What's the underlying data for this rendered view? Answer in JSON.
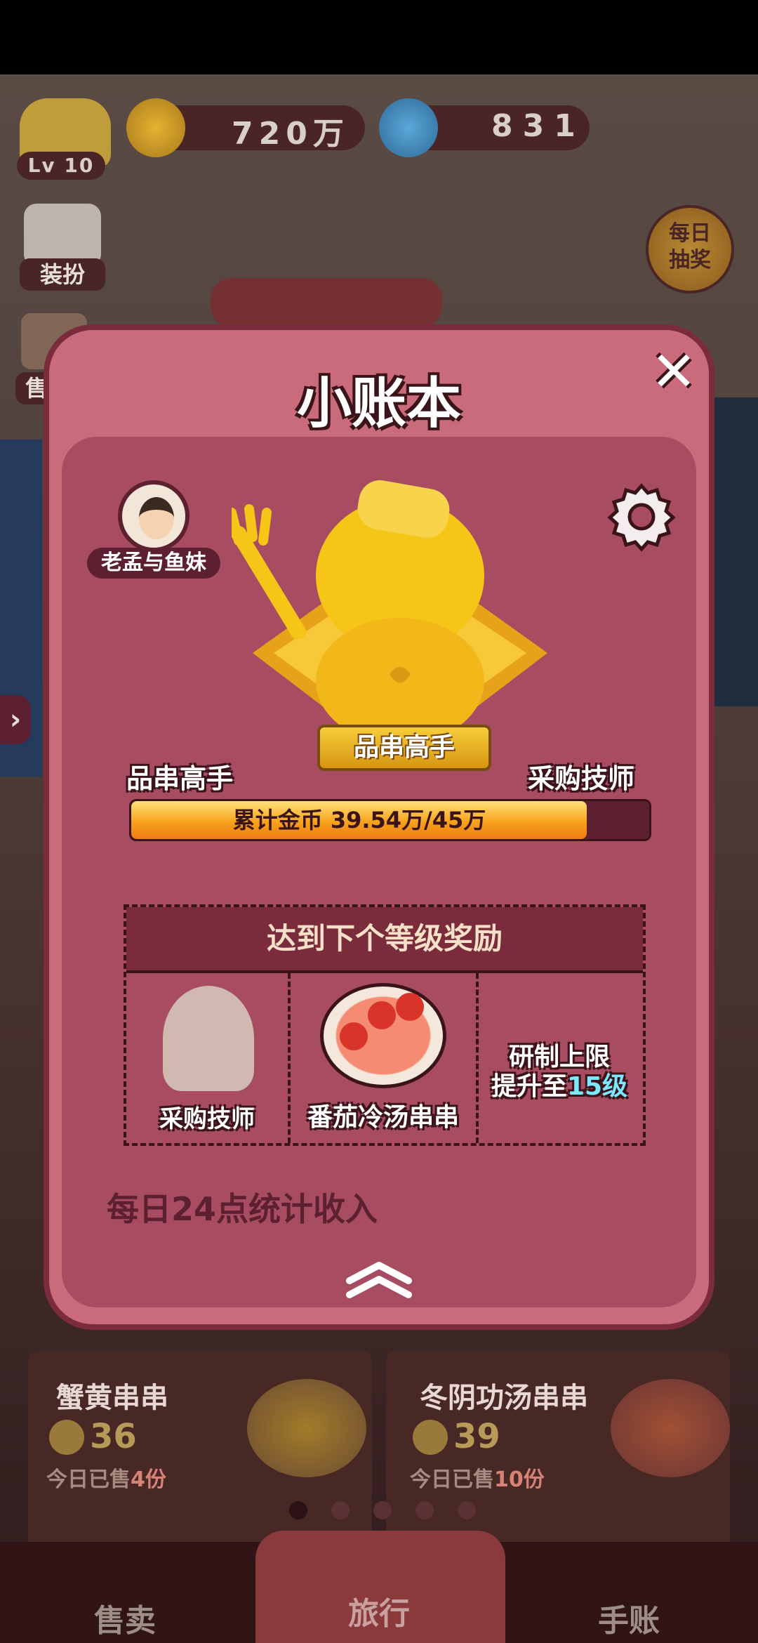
{
  "top_bar": {
    "level": "Lv 10",
    "coins": "720万",
    "buttons": "831"
  },
  "side_buttons": [
    {
      "label": "装扮"
    },
    {
      "label": "售"
    }
  ],
  "daily_lottery": {
    "label": "每日\n抽奖"
  },
  "modal": {
    "title": "小账本",
    "profile_name": "老孟与鱼妹",
    "badge_label": "品串高手",
    "current_rank": "品串高手",
    "next_rank": "采购技师",
    "progress_text": "累计金币  39.54万/45万",
    "progress_fraction": 0.879,
    "reward_header": "达到下个等级奖励",
    "rewards": [
      {
        "label": "采购技师"
      },
      {
        "label": "番茄冷汤串串"
      },
      {
        "label_line1": "研制上限",
        "label_line2_prefix": "提升至",
        "label_line2_highlight": "15级"
      }
    ],
    "footer_note": "每日24点统计收入"
  },
  "background_cards": [
    {
      "title": "蟹黄串串",
      "price": "36",
      "sold_prefix": "今日已售",
      "sold_count": "4份"
    },
    {
      "title": "冬阴功汤串串",
      "price": "39",
      "sold_prefix": "今日已售",
      "sold_count": "10份"
    }
  ],
  "bottom_nav": [
    {
      "label": "售卖"
    },
    {
      "label": "旅行"
    },
    {
      "label": "手账"
    }
  ],
  "colors": {
    "modal_bg": "#c96b7b",
    "modal_border": "#7a2c3c",
    "gold": "#f5c518",
    "highlight": "#7ae8ff"
  }
}
